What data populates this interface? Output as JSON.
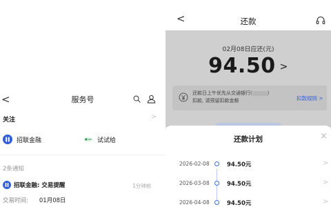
{
  "left": {
    "nav": {
      "back_glyph": "<",
      "title": "服务号"
    },
    "follow": {
      "label": "关注",
      "arrow": ">"
    },
    "accounts": [
      {
        "name": "招联金融",
        "icon": "zhaolian-logo-icon",
        "color": "#2f5fd6"
      },
      {
        "name": "试试给",
        "icon": "shishigei-logo-icon",
        "color": "#3aa35a"
      }
    ],
    "notices": {
      "count_label": "2条通知",
      "message": {
        "title": "招联金融: 交易提醒",
        "time": "1分钟前"
      },
      "trade": {
        "label": "交易时间:",
        "value": "01月08日"
      }
    }
  },
  "right": {
    "topbar": {
      "back_glyph": "<",
      "title": "还款",
      "icon": "headset-icon"
    },
    "due": {
      "label": "02月08日应还(元)",
      "amount": "94.50",
      "chevron": ">"
    },
    "tip": {
      "text_line1": "还款日上午优先从交通银行(",
      "text_line1_end": ")",
      "text_line2": "扣款, 请预留扣款金额",
      "rule_link": "扣款规则 >"
    },
    "sheet": {
      "title": "还款计划",
      "close_glyph": "×",
      "rows": [
        {
          "date": "2026-02-08",
          "amount": "94.50元"
        },
        {
          "date": "2026-03-08",
          "amount": "94.50元"
        },
        {
          "date": "2026-04-08",
          "amount": "94.50元"
        }
      ]
    },
    "colors": {
      "accent": "#2f5fd6",
      "overlay": "#cfcfcf"
    }
  }
}
